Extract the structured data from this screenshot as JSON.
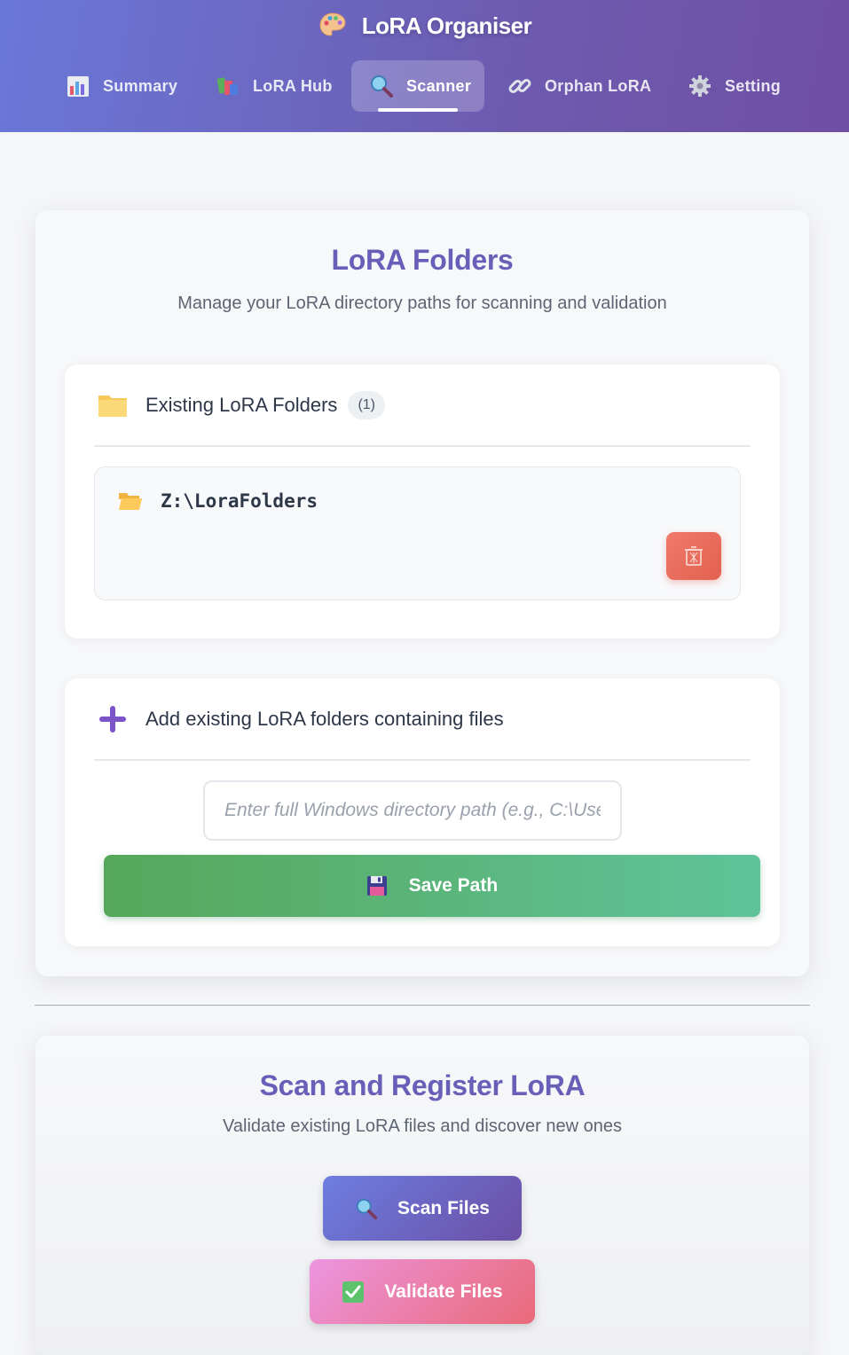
{
  "app": {
    "title": "LoRA Organiser"
  },
  "nav": {
    "tabs": [
      {
        "label": "Summary",
        "icon": "bar-chart-icon",
        "active": false
      },
      {
        "label": "LoRA Hub",
        "icon": "books-icon",
        "active": false
      },
      {
        "label": "Scanner",
        "icon": "magnifier-icon",
        "active": true
      },
      {
        "label": "Orphan LoRA",
        "icon": "link-icon",
        "active": false
      },
      {
        "label": "Setting",
        "icon": "gear-icon",
        "active": false
      }
    ]
  },
  "folders_section": {
    "title": "LoRA Folders",
    "subtitle": "Manage your LoRA directory paths for scanning and validation",
    "existing": {
      "heading": "Existing LoRA Folders",
      "count": "(1)",
      "items": [
        {
          "path": "Z:\\LoraFolders"
        }
      ]
    },
    "add": {
      "heading": "Add existing LoRA folders containing files",
      "input_placeholder": "Enter full Windows directory path (e.g., C:\\Users\\...)",
      "input_value": "",
      "save_label": "Save Path"
    }
  },
  "scan_section": {
    "title": "Scan and Register LoRA",
    "subtitle": "Validate existing LoRA files and discover new ones",
    "scan_label": "Scan Files",
    "validate_label": "Validate Files"
  },
  "colors": {
    "header_start": "#6a78d8",
    "header_end": "#6f4fa3",
    "accent_title": "#6a5fb8",
    "save_green": "#56a75a",
    "delete_red": "#e2604f"
  }
}
